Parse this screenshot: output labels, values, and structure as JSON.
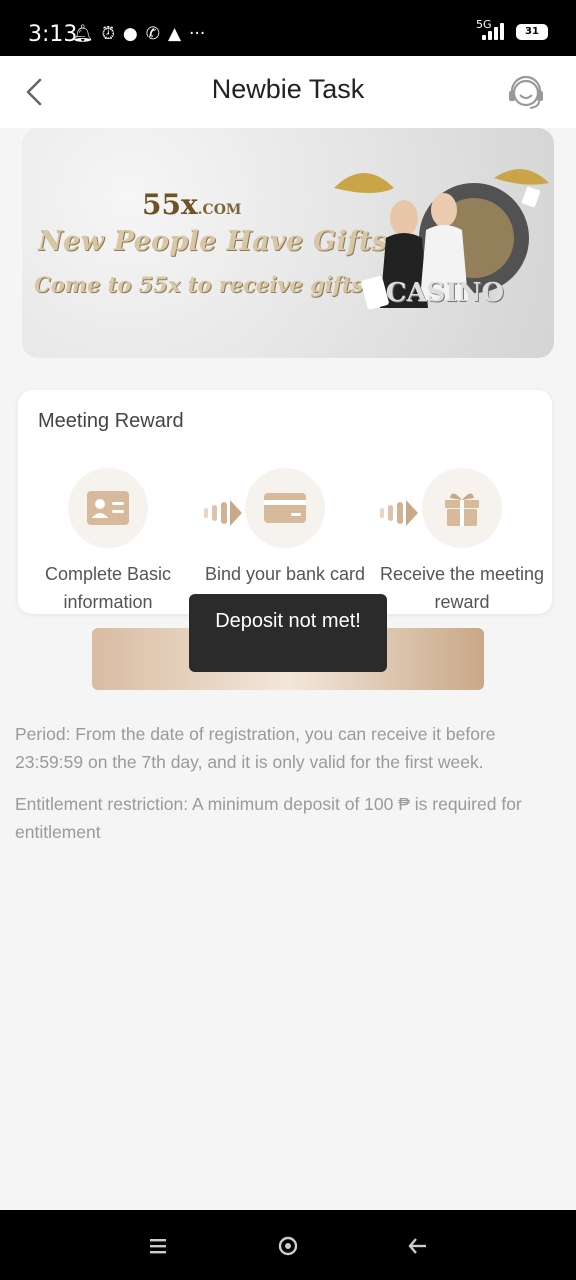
{
  "status_bar": {
    "time": "3:13",
    "icons": [
      "bell-icon",
      "alarm-icon",
      "chat-icon",
      "viber-icon",
      "app-icon",
      "more-icon"
    ],
    "network": "5G",
    "battery": "31"
  },
  "header": {
    "title": "Newbie Task"
  },
  "banner": {
    "logo": "55x",
    "logo_suffix": ".COM",
    "line1": "New People Have Gifts",
    "line2": "Come to 55x to receive gifts",
    "casino": "CASINO"
  },
  "card": {
    "title": "Meeting Reward",
    "steps": [
      {
        "label": "Complete Basic information",
        "icon": "id-card-icon"
      },
      {
        "label": "Bind your bank card",
        "icon": "bank-card-icon"
      },
      {
        "label": "Receive the meeting reward",
        "icon": "gift-icon"
      }
    ]
  },
  "toast": {
    "message": "Deposit not met!"
  },
  "info": {
    "period": "Period: From the date of registration, you can receive it before 23:59:59 on the 7th day, and it is only valid for the first week.",
    "restriction": "Entitlement restriction: A minimum deposit of 100 ₱ is required for entitlement"
  },
  "colors": {
    "accent_gold": "#c9a888",
    "text_gray": "#9a9a9a",
    "toast_bg": "#2b2b2b"
  }
}
